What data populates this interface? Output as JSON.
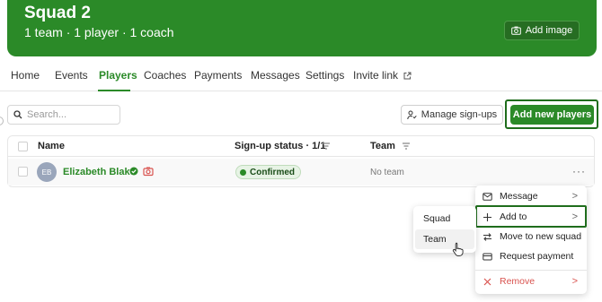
{
  "banner": {
    "title": "Squad 2",
    "subtitle": "1 team · 1 player · 1 coach",
    "add_image_label": "Add image"
  },
  "tabs": [
    {
      "label": "Home"
    },
    {
      "label": "Events"
    },
    {
      "label": "Players",
      "active": true
    },
    {
      "label": "Coaches"
    },
    {
      "label": "Payments"
    },
    {
      "label": "Messages"
    },
    {
      "label": "Settings"
    },
    {
      "label": "Invite link"
    }
  ],
  "toolbar": {
    "search_placeholder": "Search...",
    "manage_signups_label": "Manage sign-ups",
    "add_players_label": "Add new players"
  },
  "table": {
    "columns": [
      "Name",
      "Sign-up status · 1/1",
      "Team"
    ],
    "rows": [
      {
        "initials": "EB",
        "name": "Elizabeth Blake",
        "status": "Confirmed",
        "team": "No team",
        "menu": "···"
      }
    ]
  },
  "context_menu": {
    "items": [
      {
        "label": "Message",
        "icon": "message-icon",
        "chevron": ">"
      },
      {
        "label": "Add to",
        "icon": "plus-icon",
        "chevron": ">"
      },
      {
        "label": "Move to new squad",
        "icon": "swap-icon"
      },
      {
        "label": "Request payment",
        "icon": "card-icon"
      },
      {
        "label": "Remove",
        "icon": "close-icon",
        "chevron": ">"
      }
    ]
  },
  "submenu": {
    "items": [
      {
        "label": "Squad"
      },
      {
        "label": "Team"
      }
    ]
  },
  "colors": {
    "brand_green": "#2b8a28",
    "remove_red": "#d9534f"
  }
}
